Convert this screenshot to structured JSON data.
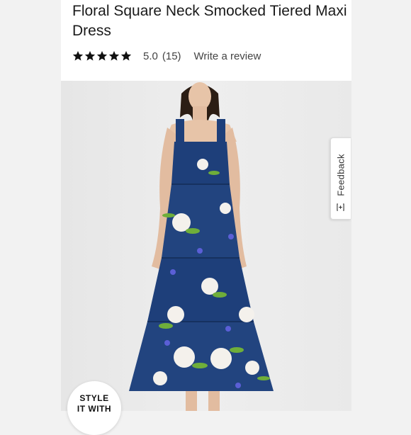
{
  "product": {
    "title": "Floral Square Neck Smocked Tiered Maxi Dress",
    "rating": {
      "stars": 5,
      "value": "5.0",
      "count": "(15)",
      "review_link": "Write a review"
    }
  },
  "feedback_tab": {
    "label": "Feedback",
    "icon": "expand-icon"
  },
  "style_badge": {
    "line1": "STYLE",
    "line2": "IT WITH"
  },
  "colors": {
    "dress": "#1e3f7a",
    "star": "#111111",
    "photo_bg": "#ececec"
  }
}
